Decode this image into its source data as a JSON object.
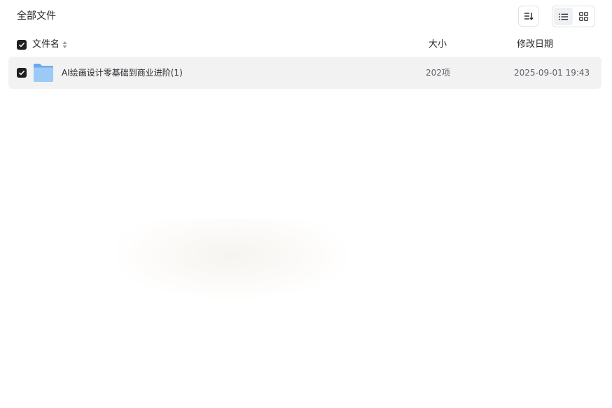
{
  "breadcrumb": {
    "title": "全部文件"
  },
  "toolbar": {
    "sort_icon": "sort-order-icon",
    "view_list_icon": "list-view-icon",
    "view_grid_icon": "grid-view-icon",
    "active_view": "list"
  },
  "table": {
    "columns": [
      "文件名",
      "大小",
      "修改日期"
    ],
    "select_all_checked": true,
    "rows": [
      {
        "name": "AI绘画设计零基础到商业进阶(1)",
        "size": "202项",
        "modified": "2025-09-01 19:43",
        "icon": "folder-icon",
        "checked": true
      }
    ]
  },
  "colors": {
    "row_selected_bg": "#f2f2f3",
    "checkbox_fill": "#1f1f1f",
    "folder_blue": "#7fb8f3"
  }
}
